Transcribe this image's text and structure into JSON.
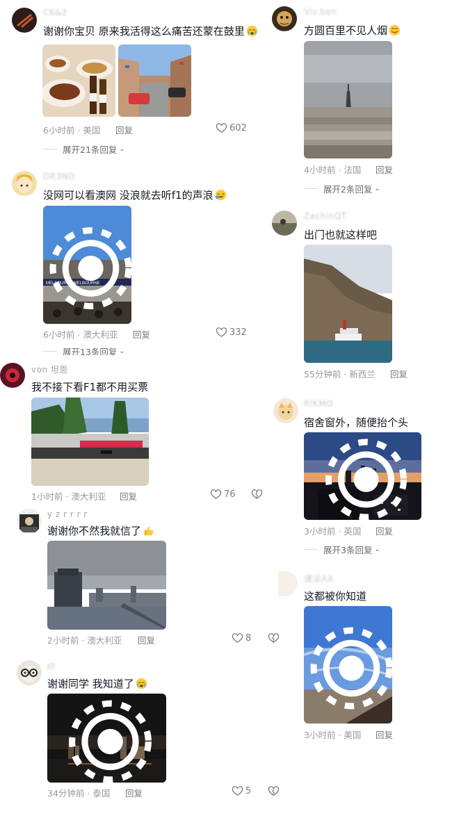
{
  "left": {
    "c1": {
      "user": "C6&2",
      "text": "谢谢你宝贝 原来我活得这么痛苦还蒙在鼓里",
      "meta": "6小时前 · 美国",
      "reply": "回复",
      "likes": "602",
      "expand": "展开21条回复"
    },
    "c2": {
      "user": "DR3NO",
      "text": "没网可以看澳网 没浪就去听f1的声浪",
      "meta": "6小时前 · 澳大利亚",
      "reply": "回复",
      "likes": "332",
      "expand": "展开13条回复"
    },
    "c3": {
      "user": "von 坦恩",
      "text": "我不接下看F1都不用买票",
      "meta": "1小时前 · 澳大利亚",
      "reply": "回复",
      "likes": "76"
    },
    "c4": {
      "user": "y z r r r r",
      "text": "谢谢你不然我就信了",
      "meta": "2小时前 · 澳大利亚",
      "reply": "回复",
      "likes": "8"
    },
    "c5": {
      "user": "吓",
      "text": "谢谢同学 我知道了",
      "meta": "34分钟前 · 泰国",
      "reply": "回复",
      "likes": "5"
    }
  },
  "right": {
    "c1": {
      "user": "Viv.bon",
      "text": "方圆百里不见人烟",
      "meta": "4小时前 · 法国",
      "reply": "回复",
      "expand": "展开2条回复"
    },
    "c2": {
      "user": "ZachinQT",
      "text": "出门也就这样吧",
      "meta": "55分钟前 · 新西兰",
      "reply": "回复"
    },
    "c3": {
      "user": "RIKMO",
      "text": "宿舍窗外，随便抬个头",
      "meta": "3小时前 · 英国",
      "reply": "回复",
      "expand": "展开3条回复"
    },
    "c4": {
      "user": "清涼AA",
      "text": "这都被你知道",
      "meta": "3小时前 · 美国",
      "reply": "回复"
    }
  },
  "icons": {
    "like": "heart-outline-icon",
    "dislike": "broken-heart-icon",
    "live": "live-photo-icon",
    "expand": "chevron-down-icon"
  }
}
